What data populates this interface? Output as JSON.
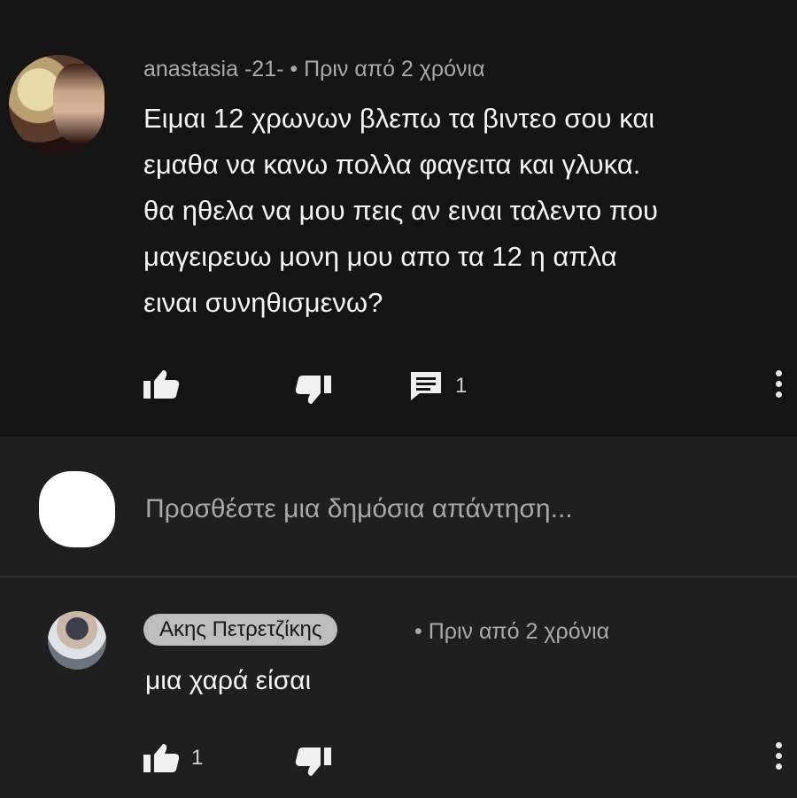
{
  "comment": {
    "author": "anastasia -21-",
    "separator": " • ",
    "timestamp": "Πριν από 2 χρόνια",
    "text": "Ειμαι 12 χρωνων βλεπω τα βιντεο σου και\nεμαθα να κανω πολλα φαγειτα και γλυκα.\nθα ηθελα να μου πεις αν ειναι ταλεντο που\nμαγειρευω μονη μου απο τα 12  η απλα\nειναι συνηθισμενω?",
    "reply_count": "1"
  },
  "reply_box": {
    "placeholder": "Προσθέστε μια δημόσια απάντηση..."
  },
  "reply": {
    "author": "Ακης Πετρετζίκης",
    "separator": "• ",
    "timestamp": "Πριν από 2 χρόνια",
    "text": "μια χαρά είσαι",
    "like_count": "1"
  },
  "colors": {
    "comment_bg": "#141414",
    "page_bg": "#1f1f1f",
    "meta_text": "#aaaaaa",
    "author_chip": "#bdbdbd"
  }
}
